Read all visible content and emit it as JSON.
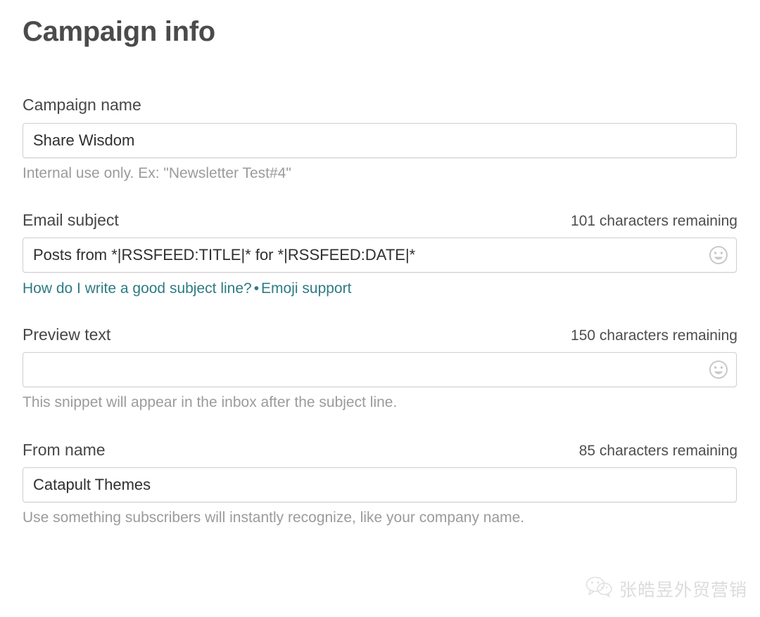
{
  "page": {
    "title": "Campaign info"
  },
  "fields": {
    "campaign_name": {
      "label": "Campaign name",
      "value": "Share Wisdom",
      "placeholder": "",
      "help": "Internal use only. Ex: \"Newsletter Test#4\""
    },
    "email_subject": {
      "label": "Email subject",
      "counter": "101 characters remaining",
      "value": "Posts from *|RSSFEED:TITLE|* for *|RSSFEED:DATE|*",
      "placeholder": "",
      "emoji_icon": "smiley-face-icon",
      "links": [
        {
          "label": "How do I write a good subject line?"
        },
        {
          "label": "Emoji support"
        }
      ],
      "link_separator": "•"
    },
    "preview_text": {
      "label": "Preview text",
      "counter": "150 characters remaining",
      "value": "",
      "placeholder": "",
      "emoji_icon": "smiley-face-icon",
      "help": "This snippet will appear in the inbox after the subject line."
    },
    "from_name": {
      "label": "From name",
      "counter": "85 characters remaining",
      "value": "Catapult Themes",
      "placeholder": "",
      "help": "Use something subscribers will instantly recognize, like your company name."
    }
  },
  "watermark": {
    "icon": "wechat-logo-icon",
    "text": "张皓昱外贸营销"
  },
  "colors": {
    "link": "#2e7b84",
    "label": "#464646",
    "help": "#9b9b9b",
    "border": "#cfcfcf"
  }
}
